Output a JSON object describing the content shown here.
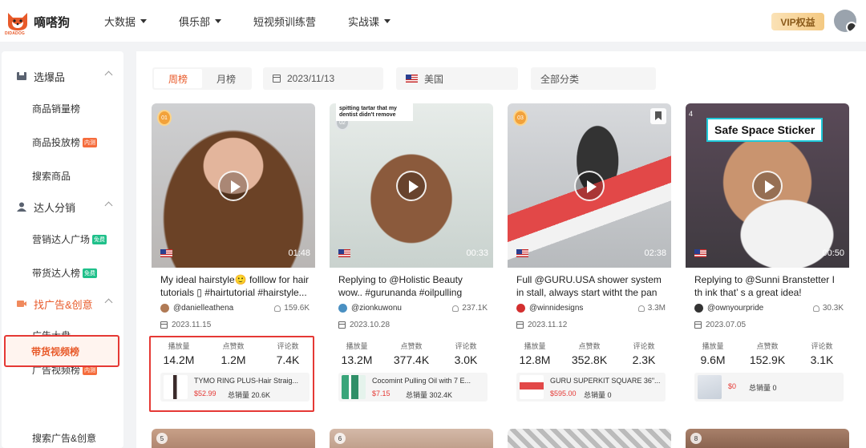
{
  "header": {
    "logo_text": "嘀嗒狗",
    "logo_sub": "DIDADOG",
    "nav": [
      {
        "label": "大数据",
        "dropdown": true
      },
      {
        "label": "俱乐部",
        "dropdown": true
      },
      {
        "label": "短视频训练营",
        "dropdown": false
      },
      {
        "label": "实战课",
        "dropdown": true
      }
    ],
    "vip_label": "VIP权益"
  },
  "sidebar": {
    "sections": [
      {
        "label": "选爆品",
        "icon": "box-icon"
      },
      {
        "label": "达人分销",
        "icon": "person-icon"
      },
      {
        "label": "找广告&创意",
        "icon": "video-icon"
      }
    ],
    "items": [
      {
        "label": "商品销量榜",
        "tag": ""
      },
      {
        "label": "商品投放榜",
        "tag": "内测"
      },
      {
        "label": "搜索商品",
        "tag": ""
      },
      {
        "label": "营销达人广场",
        "tag": "免费"
      },
      {
        "label": "带货达人榜",
        "tag": "免费"
      },
      {
        "label": "广告大盘",
        "tag": ""
      },
      {
        "label": "广告视频榜",
        "tag": "内测"
      },
      {
        "label": "带货视频榜",
        "tag": ""
      },
      {
        "label": "搜索广告&创意",
        "tag": ""
      }
    ]
  },
  "filters": {
    "tab_week": "周榜",
    "tab_month": "月榜",
    "date": "2023/11/13",
    "region": "美国",
    "category": "全部分类"
  },
  "stat_labels": {
    "plays": "播放量",
    "likes": "点赞数",
    "comments": "评论数",
    "total_sales": "总销量"
  },
  "cards": [
    {
      "rank": "01",
      "duration": "01:48",
      "title": "My ideal hairstyle🙂 folllow for hair tutorials ▯ #hairtutorial #hairstyle...",
      "author": "@danielleathena",
      "followers": "159.6K",
      "date": "2023.11.15",
      "plays": "14.2M",
      "likes": "1.2M",
      "comments": "7.4K",
      "product_name": "TYMO RING PLUS-Hair Straig...",
      "price": "$52.99",
      "total_sales": "20.6K"
    },
    {
      "rank": "02",
      "duration": "00:33",
      "overlay_text": "spitting tartar that my dentist didn't remove",
      "title": "Replying to @Holistic Beauty wow.. #gurunanda #oilpulling",
      "author": "@zionkuwonu",
      "followers": "237.1K",
      "date": "2023.10.28",
      "plays": "13.2M",
      "likes": "377.4K",
      "comments": "3.0K",
      "product_name": "Cocomint Pulling Oil with 7 E...",
      "price": "$7.15",
      "total_sales": "302.4K"
    },
    {
      "rank": "03",
      "duration": "02:38",
      "title": "Full @GURU.USA shower system in stall, always start witht the pan fir...",
      "author": "@winnidesigns",
      "followers": "3.3M",
      "date": "2023.11.12",
      "plays": "12.8M",
      "likes": "352.8K",
      "comments": "2.3K",
      "product_name": "GURU SUPERKIT SQUARE 36\"...",
      "price": "$595.00",
      "total_sales": "0"
    },
    {
      "rank": "4",
      "duration": "00:50",
      "overlay_text": "Safe Space Sticker",
      "title": "Replying to @Sunni Branstetter I th ink that’ s a great idea! #Inverted...",
      "author": "@ownyourpride",
      "followers": "30.3K",
      "date": "2023.07.05",
      "plays": "9.6M",
      "likes": "152.9K",
      "comments": "3.1K",
      "product_name": "",
      "price": "$0",
      "total_sales": "0"
    }
  ],
  "row2_ranks": [
    "5",
    "6",
    "",
    "8"
  ],
  "colors": {
    "accent": "#e85a2a",
    "highlight": "#e53935",
    "tag_red": "#f56c3c",
    "tag_green": "#1fc08a"
  }
}
